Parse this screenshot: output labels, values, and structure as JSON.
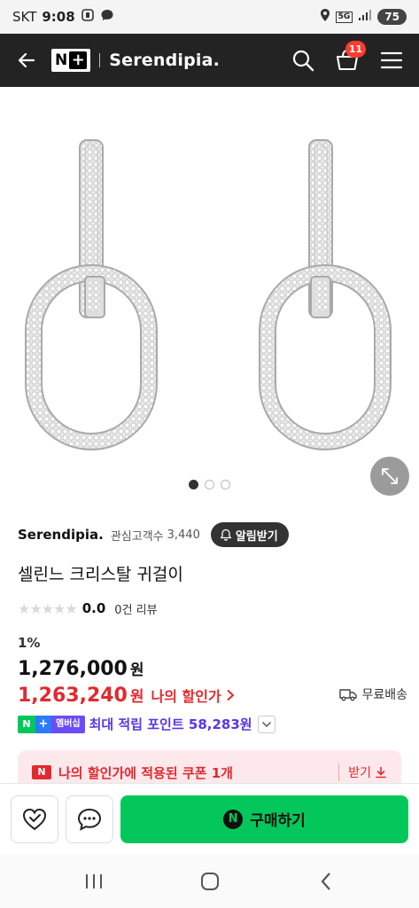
{
  "status_bar": {
    "carrier": "SKT",
    "time": "9:08",
    "network": "5G",
    "battery": "75"
  },
  "header": {
    "logo_text": "N",
    "logo_plus": "+",
    "store_name": "Serendipia.",
    "cart_count": "11"
  },
  "gallery": {
    "dot_count": 3,
    "active_index": 0
  },
  "seller": {
    "name": "Serendipia.",
    "follower_label": "관심고객수",
    "follower_count": "3,440",
    "alarm_label": "알림받기"
  },
  "product": {
    "title": "셀린느 크리스탈 귀걸이",
    "rating": "0.0",
    "review_count": "0건 리뷰",
    "discount_rate": "1%",
    "price": "1,276,000",
    "price_unit": "원",
    "sale_price": "1,263,240",
    "sale_unit": "원",
    "sale_label": "나의 할인가",
    "shipping": "무료배송"
  },
  "membership": {
    "n": "N",
    "plus": "+",
    "member": "멤버십",
    "points_text": "최대 적립 포인트 58,283원"
  },
  "coupon": {
    "icon_text": "N",
    "text": "나의 할인가에 적용된 쿠폰 1개",
    "get_label": "받기"
  },
  "actions": {
    "buy_label": "구매하기",
    "npay_mark": "N"
  },
  "colors": {
    "header_bg": "#232323",
    "naver_green": "#03c75a",
    "sale_red": "#e2292f",
    "points_purple": "#5a35e8"
  }
}
